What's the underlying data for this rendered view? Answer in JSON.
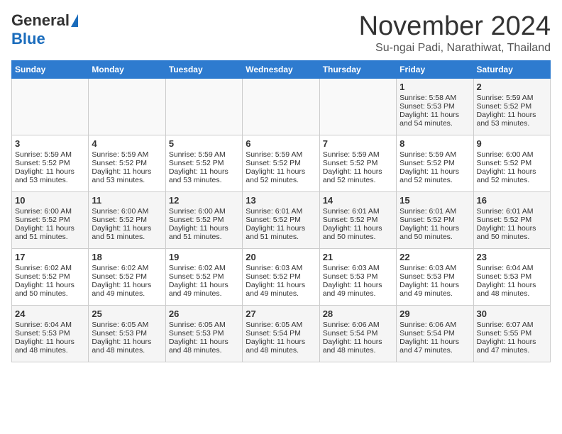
{
  "logo": {
    "general": "General",
    "blue": "Blue"
  },
  "header": {
    "title": "November 2024",
    "subtitle": "Su-ngai Padi, Narathiwat, Thailand"
  },
  "days_of_week": [
    "Sunday",
    "Monday",
    "Tuesday",
    "Wednesday",
    "Thursday",
    "Friday",
    "Saturday"
  ],
  "weeks": [
    [
      {
        "day": "",
        "sunrise": "",
        "sunset": "",
        "daylight": ""
      },
      {
        "day": "",
        "sunrise": "",
        "sunset": "",
        "daylight": ""
      },
      {
        "day": "",
        "sunrise": "",
        "sunset": "",
        "daylight": ""
      },
      {
        "day": "",
        "sunrise": "",
        "sunset": "",
        "daylight": ""
      },
      {
        "day": "",
        "sunrise": "",
        "sunset": "",
        "daylight": ""
      },
      {
        "day": "1",
        "sunrise": "Sunrise: 5:58 AM",
        "sunset": "Sunset: 5:53 PM",
        "daylight": "Daylight: 11 hours and 54 minutes."
      },
      {
        "day": "2",
        "sunrise": "Sunrise: 5:59 AM",
        "sunset": "Sunset: 5:52 PM",
        "daylight": "Daylight: 11 hours and 53 minutes."
      }
    ],
    [
      {
        "day": "3",
        "sunrise": "Sunrise: 5:59 AM",
        "sunset": "Sunset: 5:52 PM",
        "daylight": "Daylight: 11 hours and 53 minutes."
      },
      {
        "day": "4",
        "sunrise": "Sunrise: 5:59 AM",
        "sunset": "Sunset: 5:52 PM",
        "daylight": "Daylight: 11 hours and 53 minutes."
      },
      {
        "day": "5",
        "sunrise": "Sunrise: 5:59 AM",
        "sunset": "Sunset: 5:52 PM",
        "daylight": "Daylight: 11 hours and 53 minutes."
      },
      {
        "day": "6",
        "sunrise": "Sunrise: 5:59 AM",
        "sunset": "Sunset: 5:52 PM",
        "daylight": "Daylight: 11 hours and 52 minutes."
      },
      {
        "day": "7",
        "sunrise": "Sunrise: 5:59 AM",
        "sunset": "Sunset: 5:52 PM",
        "daylight": "Daylight: 11 hours and 52 minutes."
      },
      {
        "day": "8",
        "sunrise": "Sunrise: 5:59 AM",
        "sunset": "Sunset: 5:52 PM",
        "daylight": "Daylight: 11 hours and 52 minutes."
      },
      {
        "day": "9",
        "sunrise": "Sunrise: 6:00 AM",
        "sunset": "Sunset: 5:52 PM",
        "daylight": "Daylight: 11 hours and 52 minutes."
      }
    ],
    [
      {
        "day": "10",
        "sunrise": "Sunrise: 6:00 AM",
        "sunset": "Sunset: 5:52 PM",
        "daylight": "Daylight: 11 hours and 51 minutes."
      },
      {
        "day": "11",
        "sunrise": "Sunrise: 6:00 AM",
        "sunset": "Sunset: 5:52 PM",
        "daylight": "Daylight: 11 hours and 51 minutes."
      },
      {
        "day": "12",
        "sunrise": "Sunrise: 6:00 AM",
        "sunset": "Sunset: 5:52 PM",
        "daylight": "Daylight: 11 hours and 51 minutes."
      },
      {
        "day": "13",
        "sunrise": "Sunrise: 6:01 AM",
        "sunset": "Sunset: 5:52 PM",
        "daylight": "Daylight: 11 hours and 51 minutes."
      },
      {
        "day": "14",
        "sunrise": "Sunrise: 6:01 AM",
        "sunset": "Sunset: 5:52 PM",
        "daylight": "Daylight: 11 hours and 50 minutes."
      },
      {
        "day": "15",
        "sunrise": "Sunrise: 6:01 AM",
        "sunset": "Sunset: 5:52 PM",
        "daylight": "Daylight: 11 hours and 50 minutes."
      },
      {
        "day": "16",
        "sunrise": "Sunrise: 6:01 AM",
        "sunset": "Sunset: 5:52 PM",
        "daylight": "Daylight: 11 hours and 50 minutes."
      }
    ],
    [
      {
        "day": "17",
        "sunrise": "Sunrise: 6:02 AM",
        "sunset": "Sunset: 5:52 PM",
        "daylight": "Daylight: 11 hours and 50 minutes."
      },
      {
        "day": "18",
        "sunrise": "Sunrise: 6:02 AM",
        "sunset": "Sunset: 5:52 PM",
        "daylight": "Daylight: 11 hours and 49 minutes."
      },
      {
        "day": "19",
        "sunrise": "Sunrise: 6:02 AM",
        "sunset": "Sunset: 5:52 PM",
        "daylight": "Daylight: 11 hours and 49 minutes."
      },
      {
        "day": "20",
        "sunrise": "Sunrise: 6:03 AM",
        "sunset": "Sunset: 5:52 PM",
        "daylight": "Daylight: 11 hours and 49 minutes."
      },
      {
        "day": "21",
        "sunrise": "Sunrise: 6:03 AM",
        "sunset": "Sunset: 5:53 PM",
        "daylight": "Daylight: 11 hours and 49 minutes."
      },
      {
        "day": "22",
        "sunrise": "Sunrise: 6:03 AM",
        "sunset": "Sunset: 5:53 PM",
        "daylight": "Daylight: 11 hours and 49 minutes."
      },
      {
        "day": "23",
        "sunrise": "Sunrise: 6:04 AM",
        "sunset": "Sunset: 5:53 PM",
        "daylight": "Daylight: 11 hours and 48 minutes."
      }
    ],
    [
      {
        "day": "24",
        "sunrise": "Sunrise: 6:04 AM",
        "sunset": "Sunset: 5:53 PM",
        "daylight": "Daylight: 11 hours and 48 minutes."
      },
      {
        "day": "25",
        "sunrise": "Sunrise: 6:05 AM",
        "sunset": "Sunset: 5:53 PM",
        "daylight": "Daylight: 11 hours and 48 minutes."
      },
      {
        "day": "26",
        "sunrise": "Sunrise: 6:05 AM",
        "sunset": "Sunset: 5:53 PM",
        "daylight": "Daylight: 11 hours and 48 minutes."
      },
      {
        "day": "27",
        "sunrise": "Sunrise: 6:05 AM",
        "sunset": "Sunset: 5:54 PM",
        "daylight": "Daylight: 11 hours and 48 minutes."
      },
      {
        "day": "28",
        "sunrise": "Sunrise: 6:06 AM",
        "sunset": "Sunset: 5:54 PM",
        "daylight": "Daylight: 11 hours and 48 minutes."
      },
      {
        "day": "29",
        "sunrise": "Sunrise: 6:06 AM",
        "sunset": "Sunset: 5:54 PM",
        "daylight": "Daylight: 11 hours and 47 minutes."
      },
      {
        "day": "30",
        "sunrise": "Sunrise: 6:07 AM",
        "sunset": "Sunset: 5:55 PM",
        "daylight": "Daylight: 11 hours and 47 minutes."
      }
    ]
  ]
}
